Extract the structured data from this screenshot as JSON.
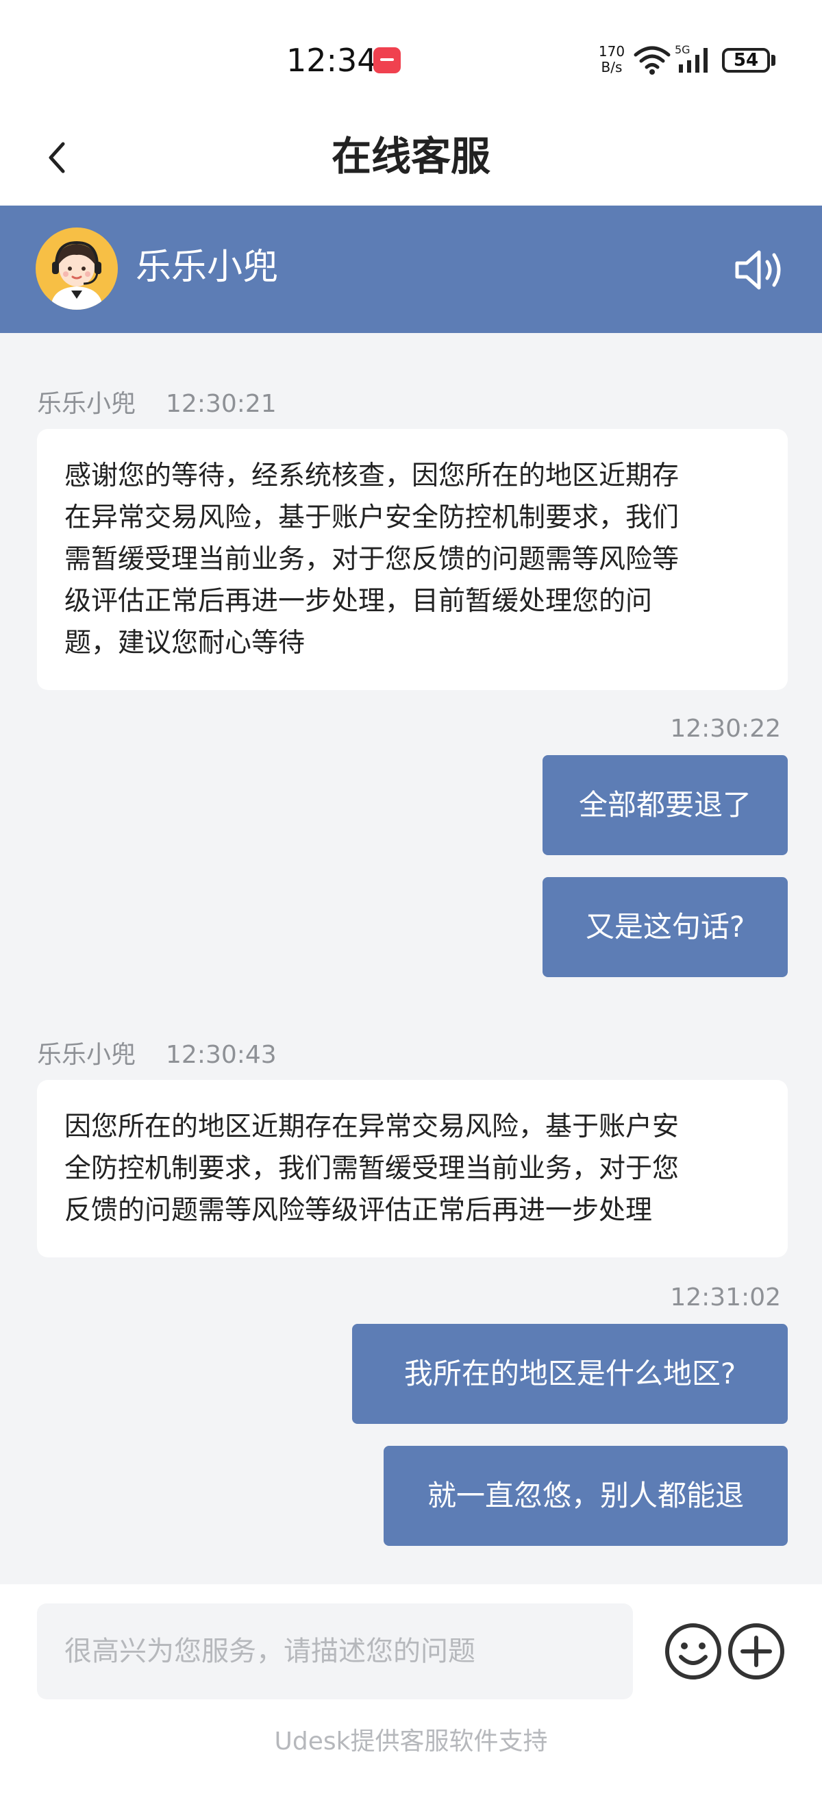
{
  "status_bar": {
    "time": "12:34",
    "net_speed_value": "170",
    "net_speed_unit": "B/s",
    "network_type": "5G",
    "battery": "54",
    "icons": [
      "huawei-app-icon",
      "wifi-icon",
      "signal-icon",
      "battery-icon"
    ]
  },
  "header": {
    "title": "在线客服",
    "back_icon": "chevron-left-icon"
  },
  "agent": {
    "name": "乐乐小兜",
    "avatar_icon": "customer-service-avatar",
    "speaker_icon": "speaker-icon"
  },
  "messages": [
    {
      "sender": "乐乐小兜",
      "time": "12:30:21",
      "lines": [
        "感谢您的等待，经系统核查，因您所在的地区近期存",
        "在异常交易风险，基于账户安全防控机制要求，我们",
        "需暂缓受理当前业务，对于您反馈的问题需等风险等",
        "级评估正常后再进一步处理，目前暂缓处理您的问",
        "题，建议您耐心等待"
      ]
    },
    {
      "time": "12:30:22",
      "text": "全部都要退了"
    },
    {
      "text": "又是这句话?"
    },
    {
      "sender": "乐乐小兜",
      "time": "12:30:43",
      "lines": [
        "因您所在的地区近期存在异常交易风险，基于账户安",
        "全防控机制要求，我们需暂缓受理当前业务，对于您",
        "反馈的问题需等风险等级评估正常后再进一步处理"
      ]
    },
    {
      "time": "12:31:02",
      "text": "我所在的地区是什么地区?"
    },
    {
      "text": "就一直忽悠，别人都能退"
    }
  ],
  "input": {
    "placeholder": "很高兴为您服务，请描述您的问题",
    "value": "",
    "emoji_icon": "emoji-icon",
    "add_icon": "plus-circle-icon"
  },
  "footer": {
    "text": "Udesk提供客服软件支持"
  },
  "colors": {
    "accent": "#5d7db5",
    "background": "#f3f4f6",
    "bubble_agent": "#ffffff",
    "timestamp": "#8e9196",
    "placeholder": "#b6b8bc",
    "avatar_bg": "#f7bf45"
  }
}
